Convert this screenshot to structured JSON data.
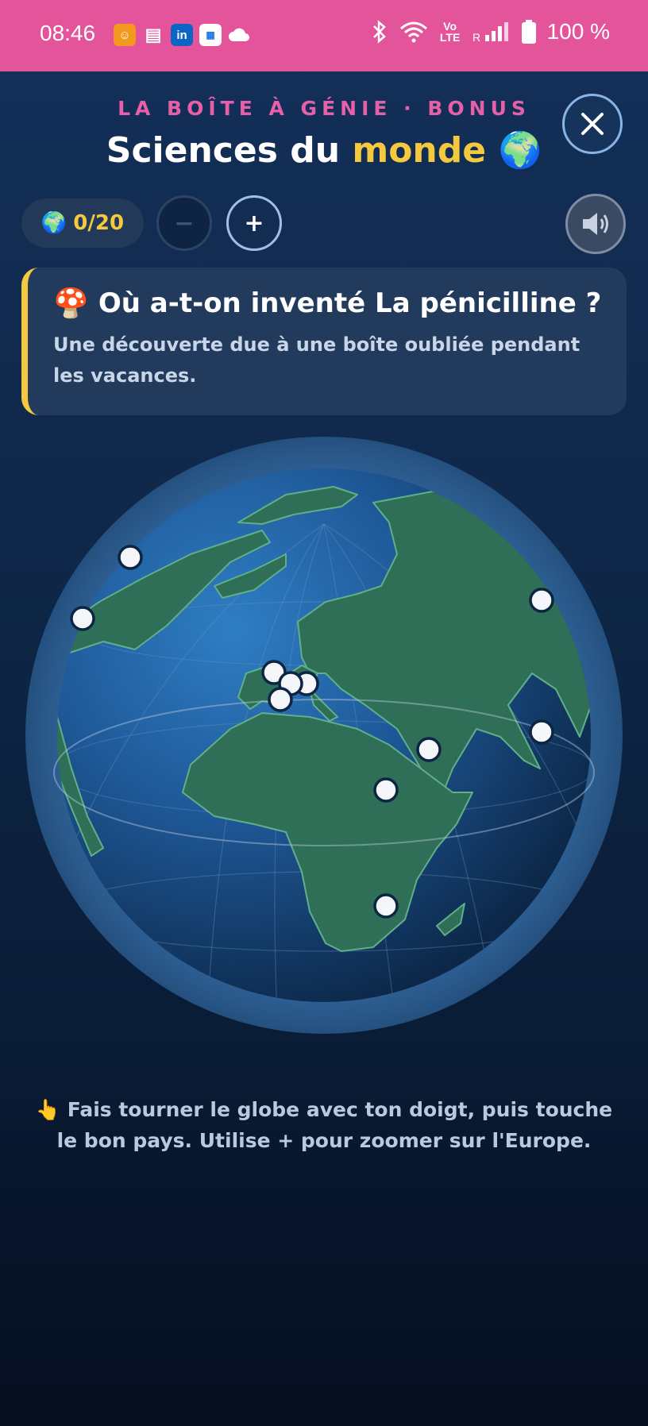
{
  "status_bar": {
    "time": "08:46",
    "battery": "100 %",
    "network_label": "Vo LTE",
    "roaming": "R",
    "app_icons": [
      "orange-app-icon",
      "sim-icon",
      "linkedin-icon",
      "calendar-icon",
      "cloud-icon"
    ],
    "linkedin_text": "in"
  },
  "header": {
    "kicker": "LA BOÎTE À GÉNIE · BONUS",
    "title_prefix": "Sciences du",
    "title_highlight": "monde",
    "title_emoji": "🌍"
  },
  "controls": {
    "score_icon": "🌍",
    "score": "0/20",
    "zoom_out_label": "−",
    "zoom_in_label": "+"
  },
  "question": {
    "emoji": "🍄",
    "text": "Où a-t-on inventé La pénicilline ?",
    "hint": "Une découverte due à une boîte oubliée pendant les vacances."
  },
  "globe": {
    "ocean_color": "#1f5a9a",
    "land_color": "#2f6f57",
    "marker_count": 13
  },
  "instruction": {
    "icon": "👆",
    "text": "Fais tourner le globe avec ton doigt, puis touche le bon pays. Utilise + pour zoomer sur l'Europe."
  },
  "colors": {
    "status_bar": "#e4549a",
    "accent_yellow": "#f5c93e",
    "accent_pink": "#e660a8"
  }
}
